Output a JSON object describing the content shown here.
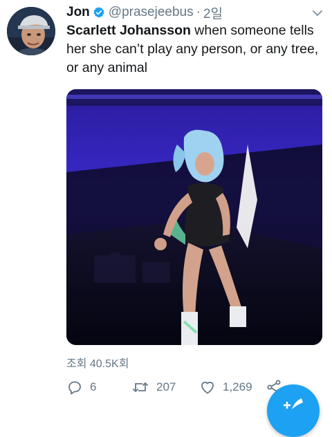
{
  "tweet": {
    "author": {
      "display_name": "Jon",
      "handle": "@prasejeebus",
      "verified": true
    },
    "separator": "·",
    "timestamp": "2일",
    "text_bold": "Scarlett Johansson",
    "text_rest": " when someone tells her she can’t play any person, or any tree, or any animal",
    "views_label": "조회 40.5K회",
    "actions": {
      "reply_count": "6",
      "retweet_count": "207",
      "like_count": "1,269"
    }
  },
  "icons": {
    "verified": "verified-badge-icon",
    "caret": "chevron-down-icon",
    "reply": "reply-icon",
    "retweet": "retweet-icon",
    "like": "heart-icon",
    "share": "share-icon",
    "compose": "compose-tweet-icon"
  },
  "colors": {
    "accent": "#1da1f2",
    "text": "#14171a",
    "muted": "#657786"
  }
}
